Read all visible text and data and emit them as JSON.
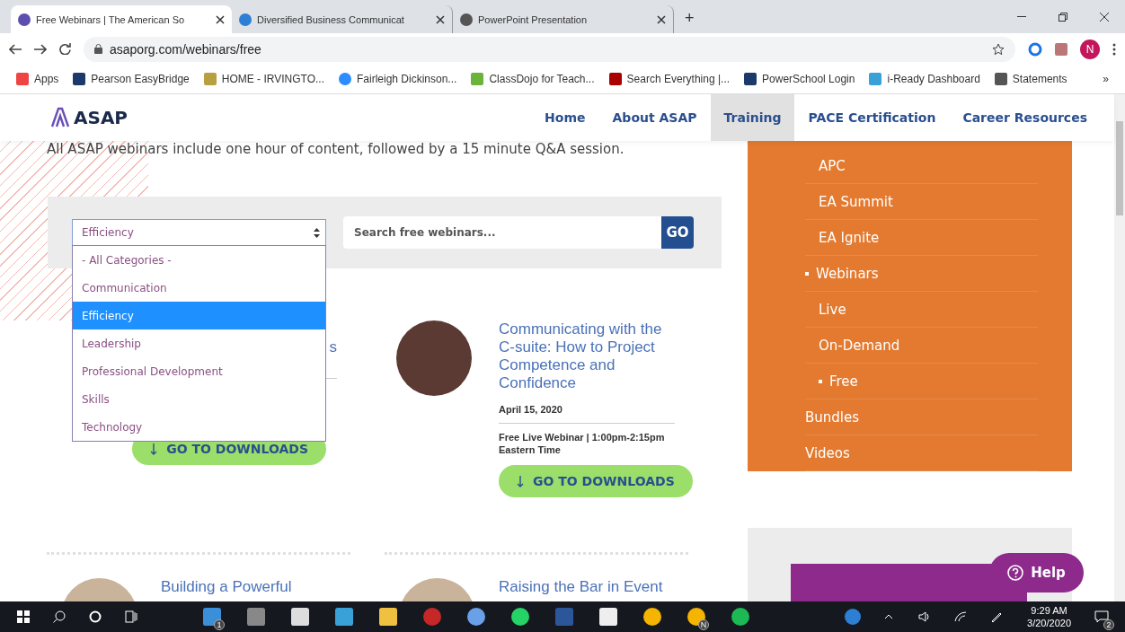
{
  "browser": {
    "tabs": [
      {
        "title": "Free Webinars | The American So",
        "selected": true
      },
      {
        "title": "Diversified Business Communicat",
        "selected": false
      },
      {
        "title": "PowerPoint Presentation",
        "selected": false
      }
    ],
    "new_tab": "+",
    "address": "asaporg.com/webinars/free",
    "profile_initial": "N",
    "bookmarks": [
      {
        "kind": "apps",
        "label": "Apps"
      },
      {
        "kind": "pearson",
        "label": "Pearson EasyBridge"
      },
      {
        "kind": "school",
        "label": "HOME - IRVINGTO..."
      },
      {
        "kind": "video",
        "label": "Fairleigh Dickinson..."
      },
      {
        "kind": "dojo",
        "label": "ClassDojo for Teach..."
      },
      {
        "kind": "usc",
        "label": "Search Everything |..."
      },
      {
        "kind": "pearson",
        "label": "PowerSchool Login"
      },
      {
        "kind": "books",
        "label": "i-Ready Dashboard"
      },
      {
        "kind": "script",
        "label": "Statements"
      }
    ],
    "more": "»"
  },
  "site": {
    "logo": "ASAP",
    "nav": [
      {
        "label": "Home",
        "selected": false
      },
      {
        "label": "About ASAP",
        "selected": false
      },
      {
        "label": "Training",
        "selected": true
      },
      {
        "label": "PACE Certification",
        "selected": false
      },
      {
        "label": "Career Resources",
        "selected": false
      }
    ],
    "intro": "All ASAP webinars include one hour of content, followed by a 15 minute Q&A session.",
    "filter": {
      "category": "Efficiency",
      "options": [
        {
          "label": "- All Categories -",
          "selected": false
        },
        {
          "label": "Communication",
          "selected": false
        },
        {
          "label": "Efficiency",
          "selected": true
        },
        {
          "label": "Leadership",
          "selected": false
        },
        {
          "label": "Professional Development",
          "selected": false
        },
        {
          "label": "Skills",
          "selected": false
        },
        {
          "label": "Technology",
          "selected": false
        }
      ],
      "search_placeholder": "Search free webinars...",
      "go": "GO"
    },
    "webinars": [
      {
        "title": "s",
        "button": "GO TO DOWNLOADS"
      },
      {
        "title": "Communicating with the C-suite: How to Project Competence and Confidence",
        "date": "April 15, 2020",
        "info": "Free Live Webinar | 1:00pm-2:15pm Eastern Time",
        "button": "GO TO DOWNLOADS"
      }
    ],
    "more_webinars": [
      {
        "title": "Building a Powerful"
      },
      {
        "title": "Raising the Bar in Event"
      }
    ],
    "training_menu": [
      {
        "children": [
          {
            "label": "APC",
            "current": false
          },
          {
            "label": "EA Summit",
            "current": false
          },
          {
            "label": "EA Ignite",
            "current": false
          }
        ]
      },
      {
        "label": "Webinars",
        "current": true,
        "children": [
          {
            "label": "Live",
            "current": false
          },
          {
            "label": "On-Demand",
            "current": false
          },
          {
            "label": "Free",
            "current": true
          }
        ]
      },
      {
        "label": "Bundles",
        "current": false
      },
      {
        "label": "Videos",
        "current": false
      }
    ],
    "help": "Help"
  },
  "taskbar": {
    "apps": [
      {
        "kind": "mail",
        "badge": "1"
      },
      {
        "kind": "mic"
      },
      {
        "kind": "calculator"
      },
      {
        "kind": "reader"
      },
      {
        "kind": "folder"
      },
      {
        "kind": "zotero"
      },
      {
        "kind": "globe"
      },
      {
        "kind": "chat"
      },
      {
        "kind": "word"
      },
      {
        "kind": "camera"
      },
      {
        "kind": "chrome"
      },
      {
        "kind": "chrome",
        "badge": "N"
      },
      {
        "kind": "music"
      }
    ],
    "time": "9:29 AM",
    "date": "3/20/2020",
    "notifications": "2"
  }
}
